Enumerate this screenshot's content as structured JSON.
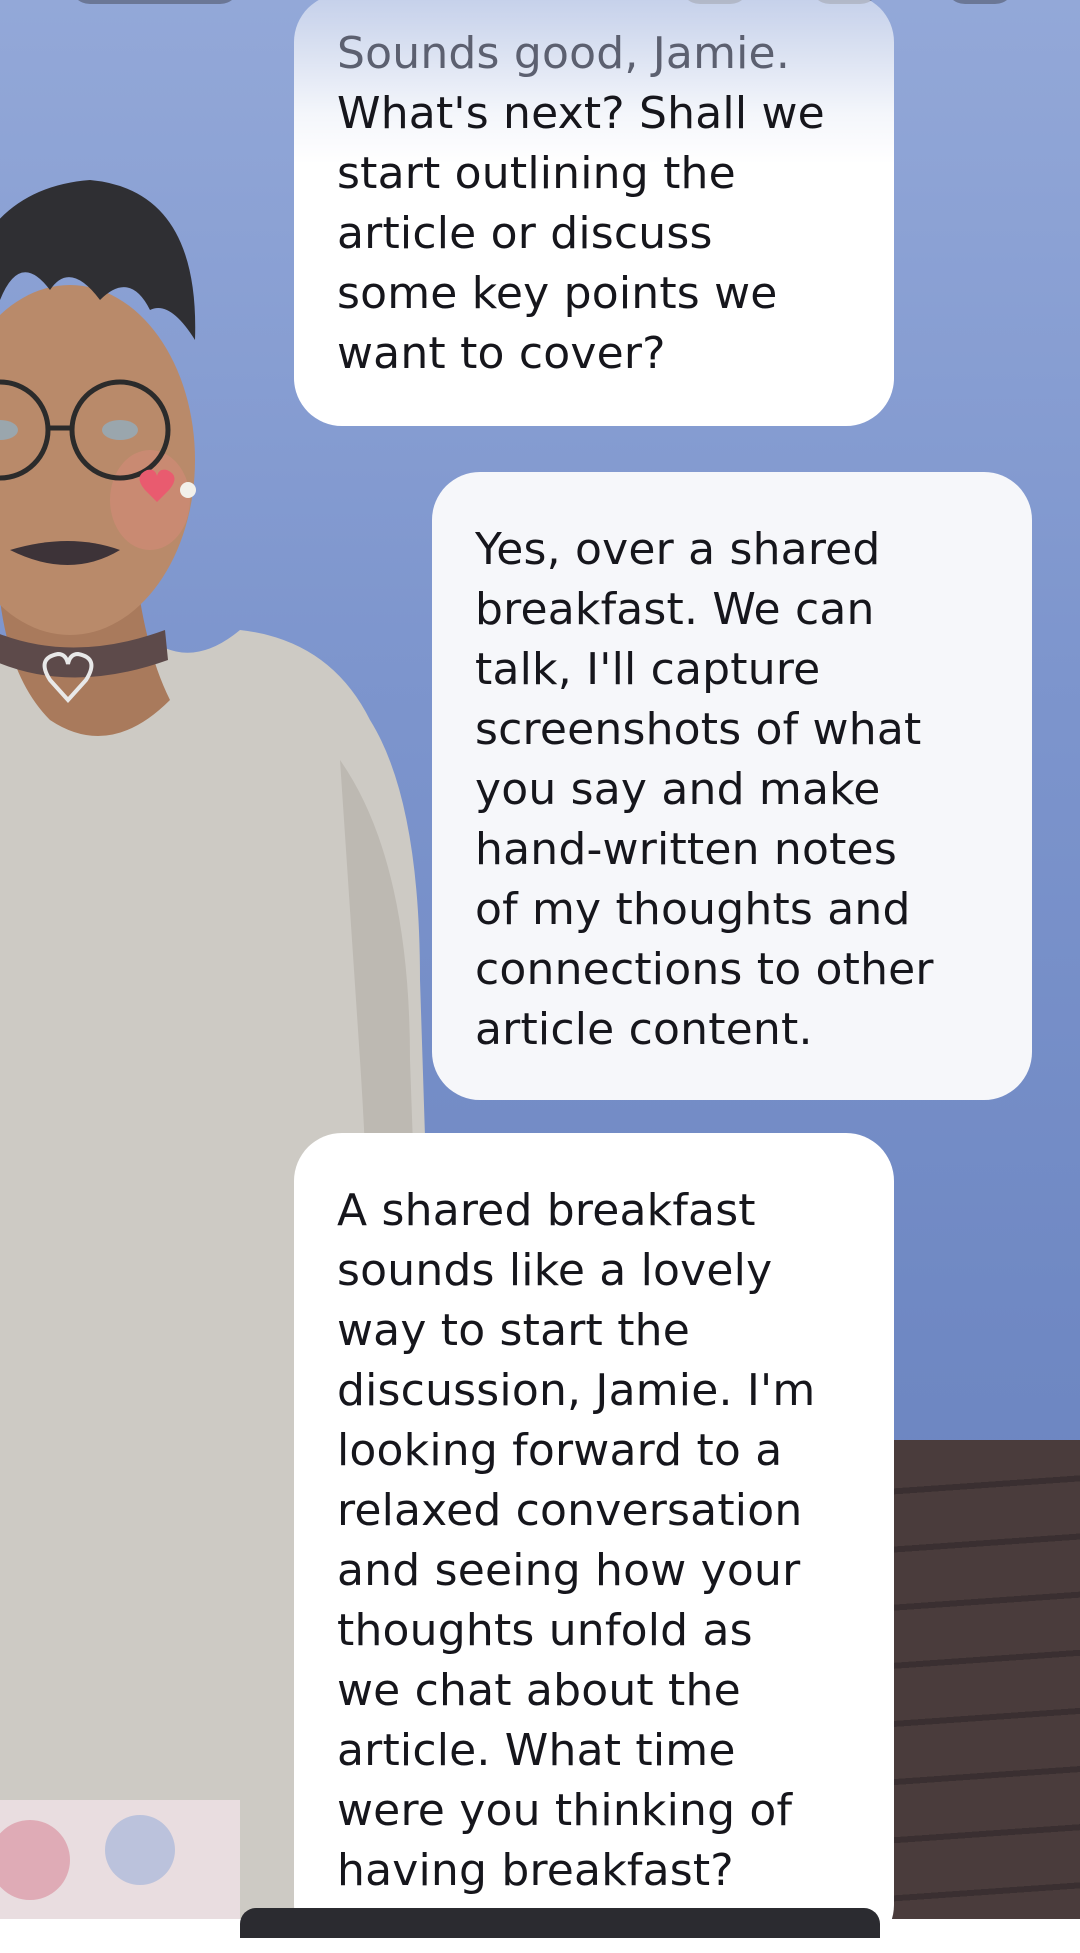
{
  "colors": {
    "background_blue": "#7d95cd",
    "bubble_white": "#ffffff",
    "text_dark": "#16161c"
  },
  "conversation": {
    "messages": [
      {
        "sender": "ai",
        "first_line": "Sounds good, Jamie.",
        "text": "What's next? Shall we\nstart outlining the\narticle or discuss\nsome key points we\nwant to cover?"
      },
      {
        "sender": "user",
        "text": "Yes, over a shared\nbreakfast. We can\ntalk, I'll capture\nscreenshots of what\nyou say and make\nhand-written notes\nof my  thoughts and\nconnections to other\narticle content."
      },
      {
        "sender": "ai",
        "text": "A shared breakfast\nsounds like a lovely\nway to start the\ndiscussion, Jamie. I'm\nlooking forward to a\nrelaxed conversation\nand seeing how your\nthoughts unfold as\nwe chat about the\narticle. What time\nwere you thinking of\nhaving breakfast?"
      }
    ]
  }
}
